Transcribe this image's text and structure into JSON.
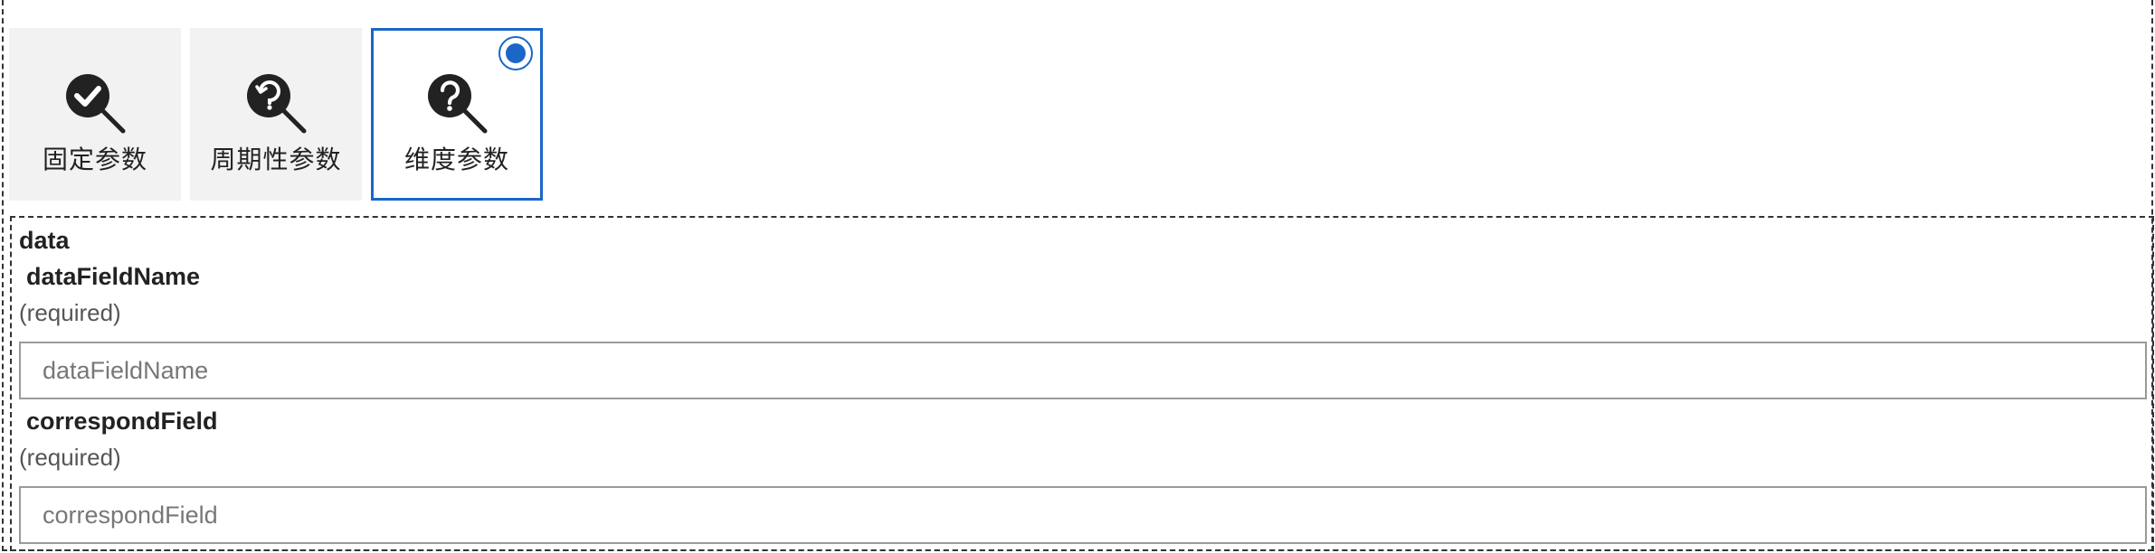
{
  "param_types": [
    {
      "label": "固定参数",
      "icon": "search-check-icon",
      "selected": false
    },
    {
      "label": "周期性参数",
      "icon": "search-refresh-icon",
      "selected": false
    },
    {
      "label": "维度参数",
      "icon": "search-question-icon",
      "selected": true
    }
  ],
  "accent_color": "#1a67c7",
  "form": {
    "section_title": "data",
    "fields": [
      {
        "label": "dataFieldName",
        "required_text": "(required)",
        "placeholder": "dataFieldName",
        "value": ""
      },
      {
        "label": "correspondField",
        "required_text": "(required)",
        "placeholder": "correspondField",
        "value": ""
      }
    ]
  }
}
